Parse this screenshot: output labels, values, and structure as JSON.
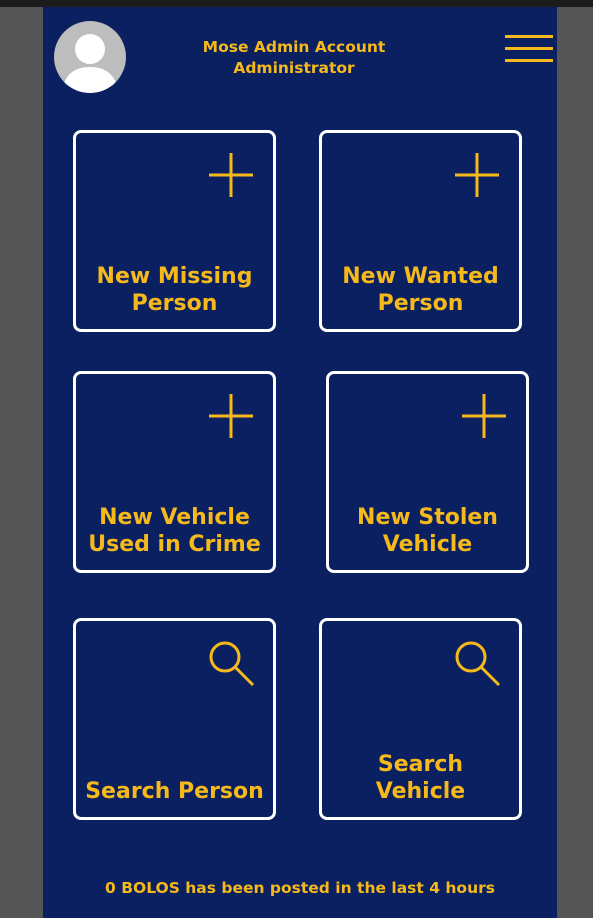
{
  "header": {
    "account_name": "Mose Admin Account",
    "role": "Administrator"
  },
  "tiles": [
    {
      "label_line1": "New Missing",
      "label_line2": "Person",
      "icon": "plus-icon"
    },
    {
      "label_line1": "New Wanted",
      "label_line2": "Person",
      "icon": "plus-icon"
    },
    {
      "label_line1": "New Vehicle",
      "label_line2": "Used in Crime",
      "icon": "plus-icon"
    },
    {
      "label_line1": "New Stolen",
      "label_line2": "Vehicle",
      "icon": "plus-icon"
    },
    {
      "label_line1": "Search Person",
      "label_line2": "",
      "icon": "search-icon"
    },
    {
      "label_line1": "Search Vehicle",
      "label_line2": "",
      "icon": "search-icon"
    }
  ],
  "status_text": "0 BOLOS has been posted in the last 4 hours",
  "colors": {
    "background": "#0a2060",
    "accent": "#f6b91b",
    "tile_border": "#ffffff"
  }
}
